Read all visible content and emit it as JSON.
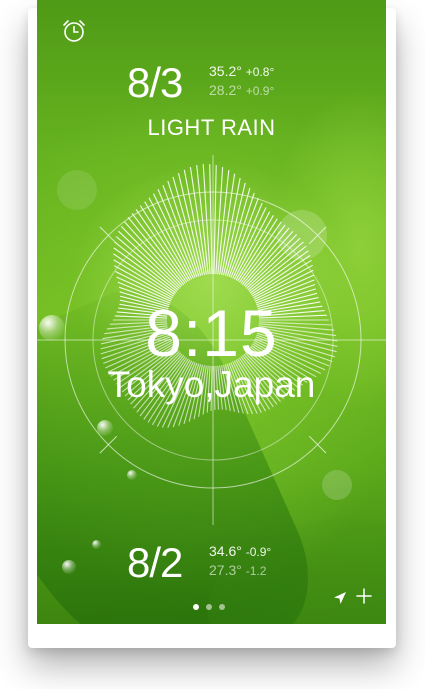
{
  "header": {
    "alarm_icon": "alarm-clock-icon"
  },
  "today": {
    "date": "8/3",
    "high_temp": "35.2°",
    "high_change": "+0.8°",
    "low_temp": "28.2°",
    "low_change": "+0.9°",
    "condition": "LIGHT RAIN"
  },
  "clock": {
    "time": "8:15",
    "location": "Tokyo,Japan"
  },
  "previous": {
    "date": "8/2",
    "high_temp": "34.6°",
    "high_change": "-0.9°",
    "low_temp": "27.3°",
    "low_change": "-1.2"
  },
  "footer": {
    "page_count": 3,
    "active_page": 1,
    "location_icon": "location-arrow-icon",
    "add_icon": "plus-icon"
  },
  "colors": {
    "foreground": "#ffffff",
    "background_green": "#6cb820"
  }
}
